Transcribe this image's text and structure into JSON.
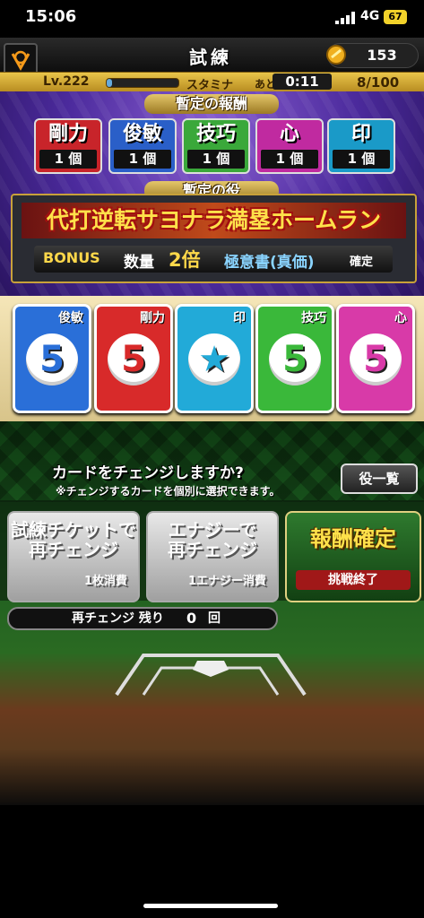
{
  "status_bar": {
    "time": "15:06",
    "network": "4G",
    "battery": "67"
  },
  "header": {
    "title": "試練",
    "coins": "153"
  },
  "level_bar": {
    "level": "Lv.222",
    "stamina_label": "スタミナ",
    "remaining_label": "あと",
    "timer": "0:11",
    "count": "8/100"
  },
  "tentative_reward": {
    "label": "暫定の報酬",
    "items": [
      {
        "label": "剛力",
        "value": "1 個",
        "color": "#c8242a"
      },
      {
        "label": "俊敏",
        "value": "1 個",
        "color": "#2a5fc8"
      },
      {
        "label": "技巧",
        "value": "1 個",
        "color": "#3aa83a"
      },
      {
        "label": "心",
        "value": "1 個",
        "color": "#c02aa0"
      },
      {
        "label": "印",
        "value": "1 個",
        "color": "#1a9ac8"
      }
    ]
  },
  "tentative_role": {
    "label": "暫定の役",
    "name": "代打逆転サヨナラ満塁ホームラン",
    "bonus_tag": "BONUS",
    "bonus_text": "数量",
    "multiplier": "2倍",
    "extra": "極意書(真価)",
    "extra_suffix": "確定"
  },
  "cards": [
    {
      "title": "俊敏",
      "value": "5",
      "color": "#2a6fd8"
    },
    {
      "title": "剛力",
      "value": "5",
      "color": "#d82a2a"
    },
    {
      "title": "印",
      "value": "★",
      "color": "#22aad8"
    },
    {
      "title": "技巧",
      "value": "5",
      "color": "#3ab83a"
    },
    {
      "title": "心",
      "value": "5",
      "color": "#d83aa8"
    }
  ],
  "change_prompt": {
    "question": "カードをチェンジしますか?",
    "note": "※チェンジするカードを個別に選択できます。",
    "list_button": "役一覧"
  },
  "actions": {
    "ticket": {
      "line1": "試練チケットで",
      "line2": "再チェンジ",
      "sub": "1枚消費"
    },
    "energy": {
      "line1": "エナジーで",
      "line2": "再チェンジ",
      "sub": "1エナジー消費"
    },
    "confirm": {
      "title": "報酬確定",
      "sub": "挑戦終了"
    }
  },
  "rechange": {
    "label": "再チェンジ 残り",
    "count": "0",
    "unit": "回"
  }
}
